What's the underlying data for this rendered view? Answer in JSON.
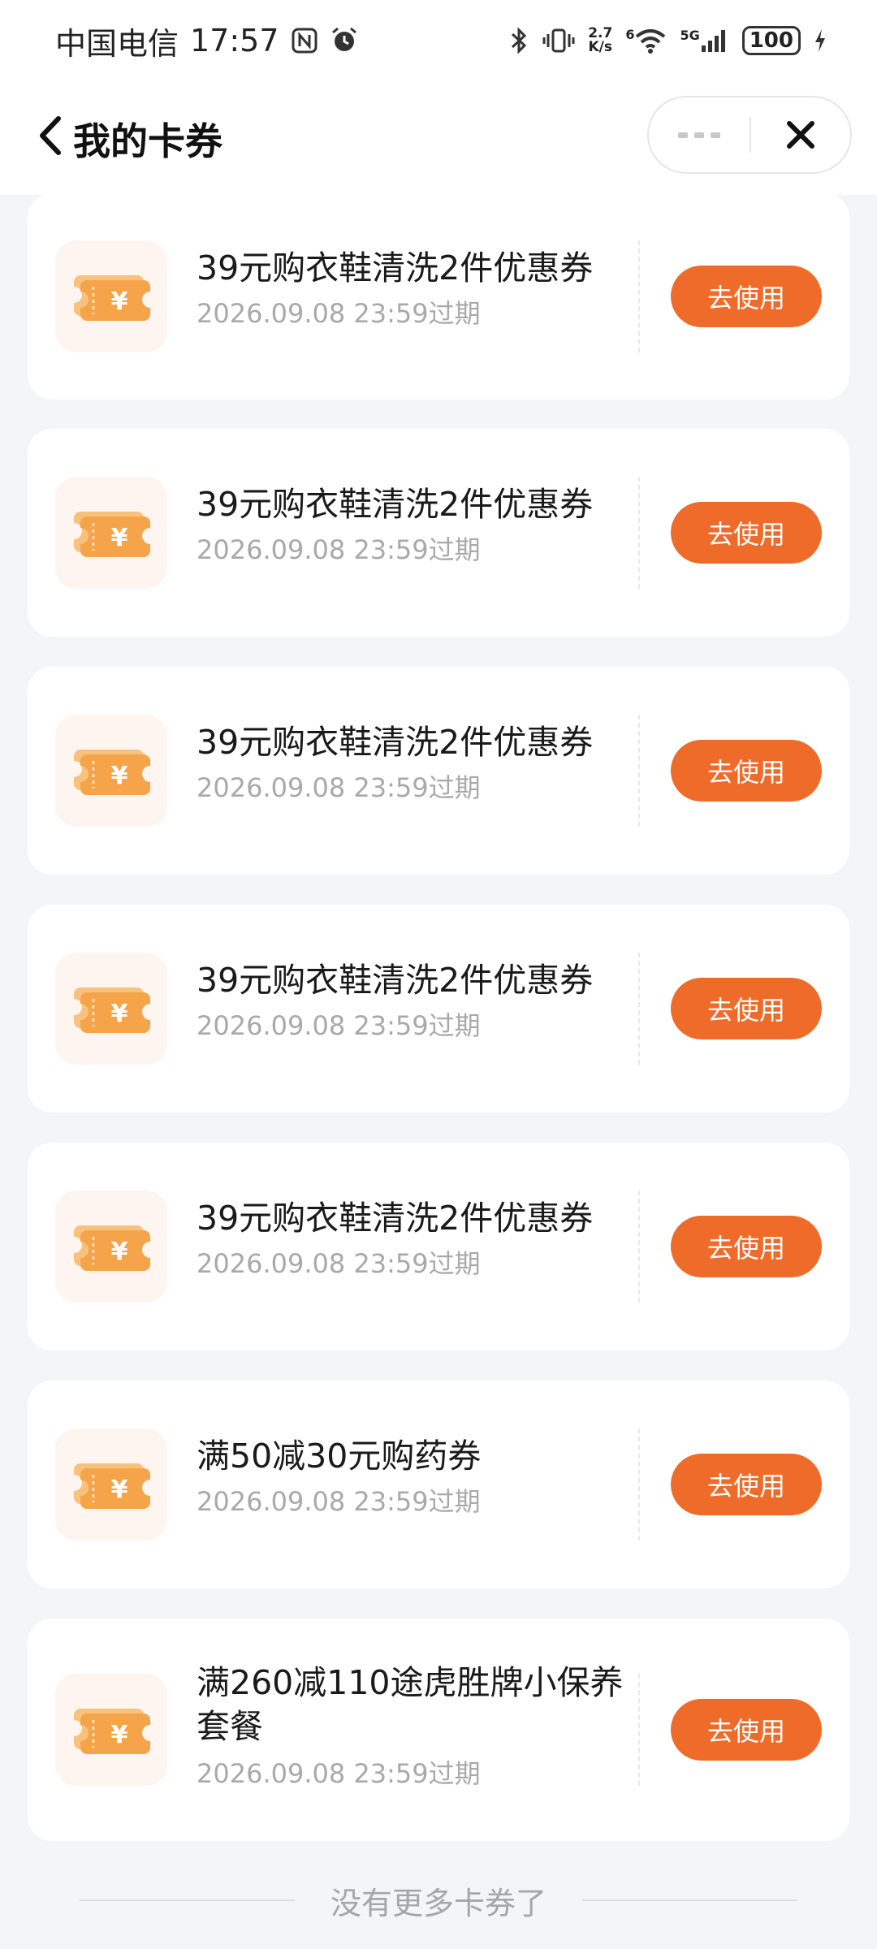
{
  "status_bar": {
    "carrier": "中国电信",
    "time": "17:57",
    "network_speed_top": "2.7",
    "network_speed_bottom": "K/s",
    "wifi_label": "6",
    "signal_label": "5G",
    "battery": "100",
    "icons": [
      "nfc-icon",
      "alarm-icon",
      "bluetooth-icon",
      "vibrate-icon",
      "wifi-icon",
      "signal-icon",
      "battery-icon",
      "charging-icon"
    ]
  },
  "header": {
    "title": "我的卡券",
    "icons": [
      "back-arrow-icon",
      "more-dots-icon",
      "close-icon"
    ]
  },
  "colors": {
    "accent": "#ef6b2a",
    "coupon_icon": "#f6a44a",
    "background": "#f4f5f7"
  },
  "coupons": [
    {
      "title": "39元购衣鞋清洗2件优惠券",
      "expiry": "2026.09.08 23:59过期",
      "button": "去使用"
    },
    {
      "title": "39元购衣鞋清洗2件优惠券",
      "expiry": "2026.09.08 23:59过期",
      "button": "去使用"
    },
    {
      "title": "39元购衣鞋清洗2件优惠券",
      "expiry": "2026.09.08 23:59过期",
      "button": "去使用"
    },
    {
      "title": "39元购衣鞋清洗2件优惠券",
      "expiry": "2026.09.08 23:59过期",
      "button": "去使用"
    },
    {
      "title": "39元购衣鞋清洗2件优惠券",
      "expiry": "2026.09.08 23:59过期",
      "button": "去使用"
    },
    {
      "title": "满50减30元购药券",
      "expiry": "2026.09.08 23:59过期",
      "button": "去使用"
    },
    {
      "title": "满260减110途虎胜牌小保养套餐",
      "expiry": "2026.09.08 23:59过期",
      "button": "去使用"
    }
  ],
  "footer": {
    "text": "没有更多卡券了"
  }
}
